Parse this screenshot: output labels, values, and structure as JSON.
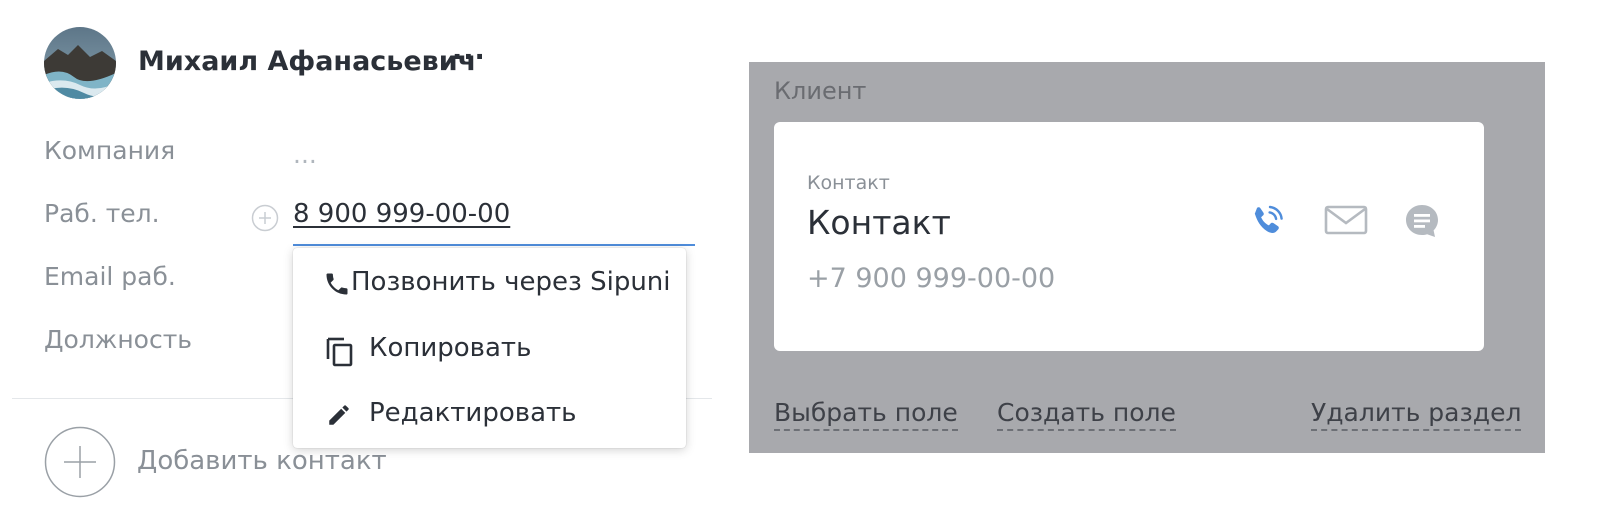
{
  "contact": {
    "name": "Михаил Афанасьевич",
    "more_label": "···",
    "fields": {
      "company_label": "Компания",
      "company_value": "...",
      "phone_label": "Раб. тел.",
      "phone_value": "8 900 999-00-00",
      "email_label": "Email раб.",
      "position_label": "Должность"
    },
    "add_contact_label": "Добавить контакт"
  },
  "phone_menu": {
    "items": [
      {
        "label": "Позвонить через Sipuni",
        "icon": "phone-icon"
      },
      {
        "label": "Копировать",
        "icon": "copy-icon"
      },
      {
        "label": "Редактировать",
        "icon": "pencil-icon"
      }
    ]
  },
  "client_panel": {
    "title": "Клиент",
    "card": {
      "small_label": "Контакт",
      "title": "Контакт",
      "phone": "+7 900 999-00-00",
      "icons": [
        "phone-call-icon",
        "mail-icon",
        "chat-icon"
      ]
    },
    "links": {
      "select_field": "Выбрать поле",
      "create_field": "Создать поле",
      "delete_section": "Удалить раздел"
    }
  },
  "colors": {
    "accent": "#4f8ddb",
    "panel_bg": "#a8a9ad",
    "muted_text": "#8a9097"
  }
}
